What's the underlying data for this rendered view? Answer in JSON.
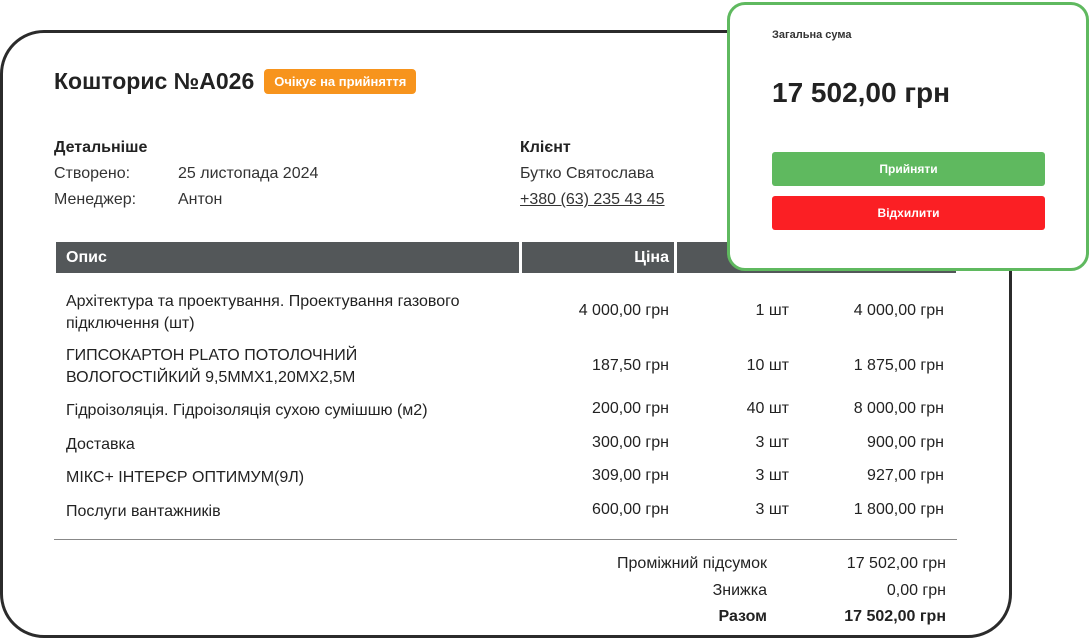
{
  "estimate": {
    "title": "Кошторис №А026",
    "status": "Очікує на прийняття",
    "details": {
      "heading": "Детальніше",
      "created_label": "Створено:",
      "created_value": "25 листопада 2024",
      "manager_label": "Менеджер:",
      "manager_value": "Антон"
    },
    "client": {
      "heading": "Клієнт",
      "name": "Бутко Святослава",
      "phone": "+380 (63) 235 43 45"
    },
    "table": {
      "headers": [
        "Опис",
        "Ціна"
      ],
      "rows": [
        {
          "desc_line1": "Архітектура та проектування. Проектування газового",
          "desc_line2": "підключення (шт)",
          "price": "4 000,00 грн",
          "qty": "1 шт",
          "total": "4 000,00 грн"
        },
        {
          "desc_line1": "ГИПСОКАРТОН PLATO ПОТОЛОЧНИЙ",
          "desc_line2": "ВОЛОГОСТІЙКИЙ 9,5ММХ1,20МХ2,5М",
          "price": "187,50 грн",
          "qty": "10 шт",
          "total": "1 875,00 грн"
        },
        {
          "desc_line1": "Гідроізоляція. Гідроізоляція сухою сумішшю (м2)",
          "desc_line2": "",
          "price": "200,00 грн",
          "qty": "40 шт",
          "total": "8 000,00 грн"
        },
        {
          "desc_line1": "Доставка",
          "desc_line2": "",
          "price": "300,00 грн",
          "qty": "3 шт",
          "total": "900,00 грн"
        },
        {
          "desc_line1": "МІКС+ ІНТЕРЄР ОПТИМУМ(9Л)",
          "desc_line2": "",
          "price": "309,00 грн",
          "qty": "3 шт",
          "total": "927,00 грн"
        },
        {
          "desc_line1": "Послуги вантажників",
          "desc_line2": "",
          "price": "600,00 грн",
          "qty": "3 шт",
          "total": "1 800,00 грн"
        }
      ]
    },
    "summary": {
      "subtotal_label": "Проміжний підсумок",
      "subtotal_value": "17 502,00 грн",
      "discount_label": "Знижка",
      "discount_value": "0,00 грн",
      "total_label": "Разом",
      "total_value": "17 502,00 грн"
    }
  },
  "card": {
    "label": "Загальна сума",
    "total": "17 502,00 грн",
    "accept_label": "Прийняти",
    "reject_label": "Відхилити"
  },
  "colors": {
    "badge": "#f7941d",
    "table_header": "#535759",
    "accept": "#5fb95f",
    "reject": "#fb1f24",
    "card_border": "#5fb95f"
  }
}
